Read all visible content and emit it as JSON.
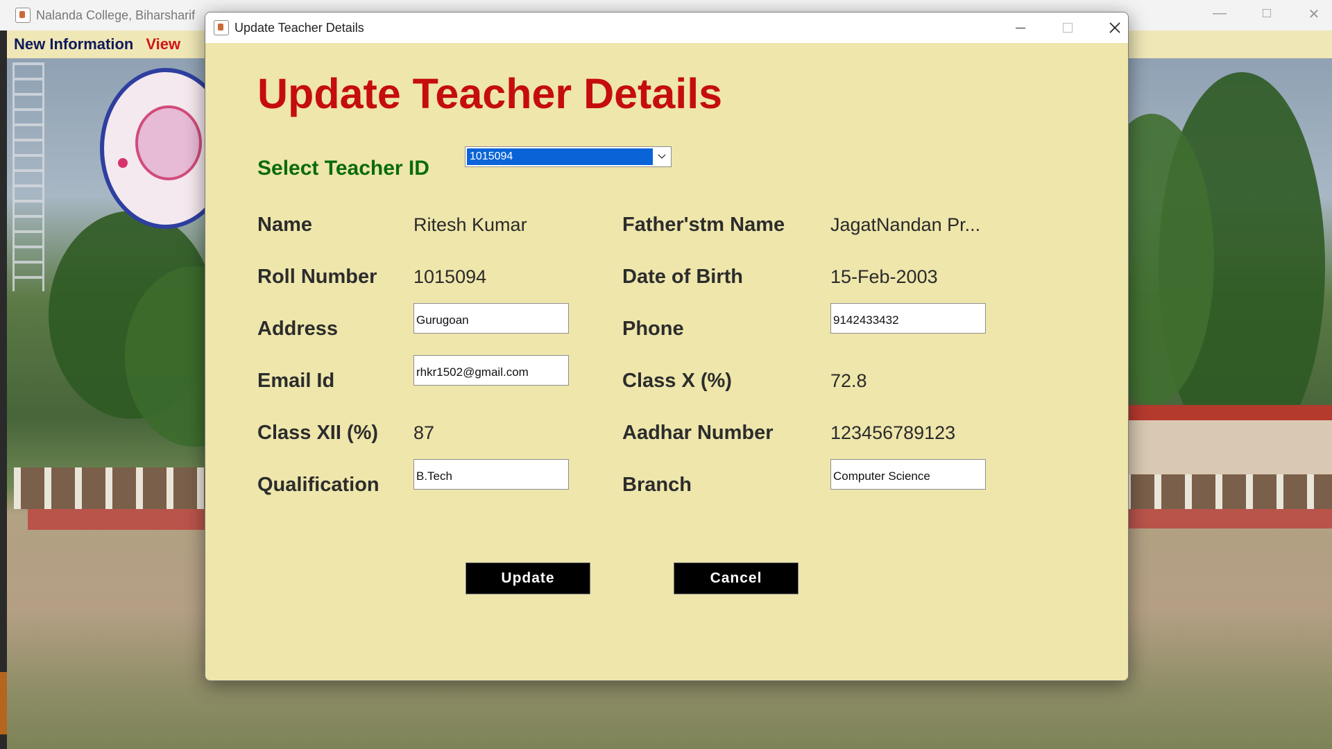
{
  "main_window": {
    "title": "Nalanda College, Biharsharif",
    "menu": {
      "new_information": "New Information",
      "view": "View"
    }
  },
  "dialog": {
    "title": "Update Teacher Details",
    "heading": "Update Teacher Details",
    "select_label": "Select Teacher ID",
    "selected_teacher_id": "1015094",
    "fields": {
      "name": {
        "label": "Name",
        "value": "Ritesh Kumar"
      },
      "father_name": {
        "label": "Father'stm Name",
        "value": "JagatNandan Pr..."
      },
      "roll_number": {
        "label": "Roll Number",
        "value": "1015094"
      },
      "date_of_birth": {
        "label": "Date of Birth",
        "value": "15-Feb-2003"
      },
      "address": {
        "label": "Address",
        "value": "Gurugoan"
      },
      "phone": {
        "label": "Phone",
        "value": "9142433432"
      },
      "email": {
        "label": "Email Id",
        "value": "rhkr1502@gmail.com"
      },
      "class_x": {
        "label": "Class X (%)",
        "value": "72.8"
      },
      "class_xii": {
        "label": "Class XII (%)",
        "value": "87"
      },
      "aadhar": {
        "label": "Aadhar Number",
        "value": "123456789123"
      },
      "qualification": {
        "label": "Qualification",
        "value": "B.Tech"
      },
      "branch": {
        "label": "Branch",
        "value": "Computer Science"
      }
    },
    "buttons": {
      "update": "Update",
      "cancel": "Cancel"
    }
  },
  "colors": {
    "dialog_bg": "#eee6ab",
    "heading": "#c50d0d",
    "select_label": "#0b6b0b",
    "selection": "#0a64d8",
    "button_bg": "#000000"
  }
}
